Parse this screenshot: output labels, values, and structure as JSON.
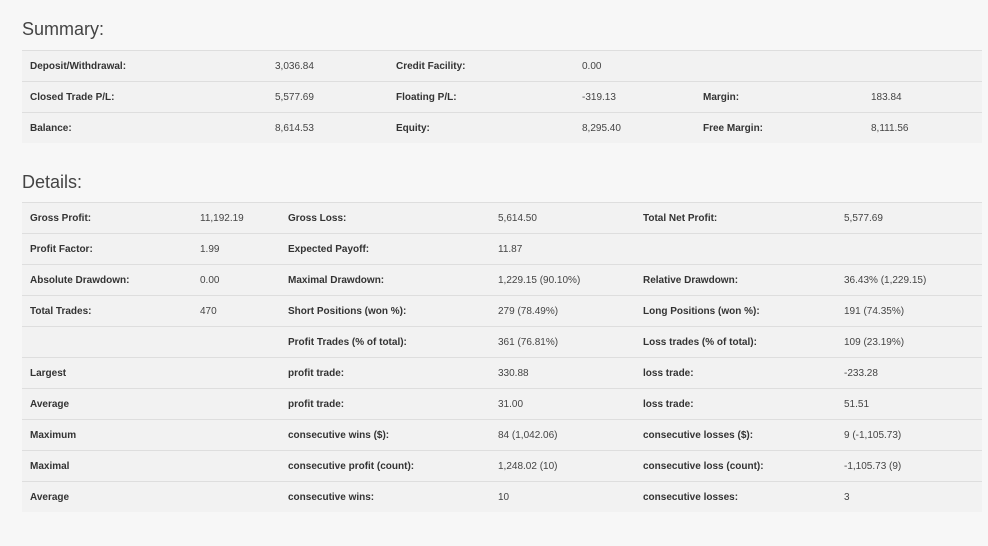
{
  "summary": {
    "title": "Summary:",
    "rows": [
      [
        "Deposit/Withdrawal:",
        "3,036.84",
        "Credit Facility:",
        "0.00",
        "",
        ""
      ],
      [
        "Closed Trade P/L:",
        "5,577.69",
        "Floating P/L:",
        "-319.13",
        "Margin:",
        "183.84"
      ],
      [
        "Balance:",
        "8,614.53",
        "Equity:",
        "8,295.40",
        "Free Margin:",
        "8,111.56"
      ]
    ]
  },
  "details": {
    "title": "Details:",
    "rows": [
      [
        "Gross Profit:",
        "11,192.19",
        "Gross Loss:",
        "5,614.50",
        "Total Net Profit:",
        "5,577.69"
      ],
      [
        "Profit Factor:",
        "1.99",
        "Expected Payoff:",
        "11.87",
        "",
        ""
      ],
      [
        "Absolute Drawdown:",
        "0.00",
        "Maximal Drawdown:",
        "1,229.15 (90.10%)",
        "Relative Drawdown:",
        "36.43% (1,229.15)"
      ],
      [
        "Total Trades:",
        "470",
        "Short Positions (won %):",
        "279 (78.49%)",
        "Long Positions (won %):",
        "191 (74.35%)"
      ],
      [
        "",
        "",
        "Profit Trades (% of total):",
        "361 (76.81%)",
        "Loss trades (% of total):",
        "109 (23.19%)"
      ],
      [
        "Largest",
        "",
        "profit trade:",
        "330.88",
        "loss trade:",
        "-233.28"
      ],
      [
        "Average",
        "",
        "profit trade:",
        "31.00",
        "loss trade:",
        "51.51"
      ],
      [
        "Maximum",
        "",
        "consecutive wins ($):",
        "84 (1,042.06)",
        "consecutive losses ($):",
        "9 (-1,105.73)"
      ],
      [
        "Maximal",
        "",
        "consecutive profit (count):",
        "1,248.02 (10)",
        "consecutive loss (count):",
        "-1,105.73 (9)"
      ],
      [
        "Average",
        "",
        "consecutive wins:",
        "10",
        "consecutive losses:",
        "3"
      ]
    ]
  }
}
